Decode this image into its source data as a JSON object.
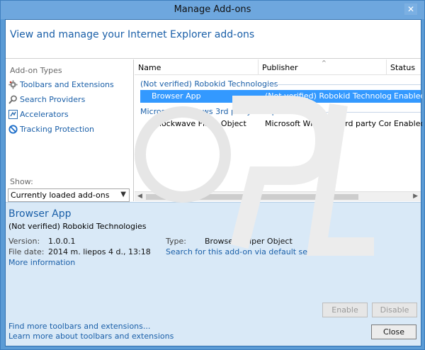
{
  "window": {
    "title": "Manage Add-ons"
  },
  "header": {
    "heading": "View and manage your Internet Explorer add-ons"
  },
  "sidebar": {
    "section_label": "Add-on Types",
    "items": [
      {
        "label": "Toolbars and Extensions",
        "icon": "gear-icon"
      },
      {
        "label": "Search Providers",
        "icon": "search-icon"
      },
      {
        "label": "Accelerators",
        "icon": "accelerator-icon"
      },
      {
        "label": "Tracking Protection",
        "icon": "block-icon"
      }
    ],
    "show_label": "Show:",
    "show_value": "Currently loaded add-ons"
  },
  "list": {
    "columns": [
      "Name",
      "Publisher",
      "Status"
    ],
    "groups": [
      {
        "name": "(Not verified) Robokid Technologies",
        "rows": [
          {
            "name": "Browser App",
            "publisher": "(Not verified) Robokid Technologies",
            "status": "Enabled",
            "selected": true
          }
        ]
      },
      {
        "name": "Microsoft Windows 3rd party Component",
        "rows": [
          {
            "name": "Shockwave Flash Object",
            "publisher": "Microsoft Windows 3rd party Com...",
            "status": "Enabled",
            "selected": false
          }
        ]
      }
    ]
  },
  "details": {
    "title": "Browser App",
    "publisher": "(Not verified) Robokid Technologies",
    "version_label": "Version:",
    "version": "1.0.0.1",
    "filedate_label": "File date:",
    "filedate": "2014 m. liepos 4 d., 13:18",
    "more_info": "More information",
    "type_label": "Type:",
    "type": "Browser Helper Object",
    "search_link": "Search for this add-on via default search provi...",
    "enable_label": "Enable",
    "disable_label": "Disable",
    "find_more": "Find more toolbars and extensions...",
    "learn_more": "Learn more about toolbars and extensions",
    "close_label": "Close"
  }
}
